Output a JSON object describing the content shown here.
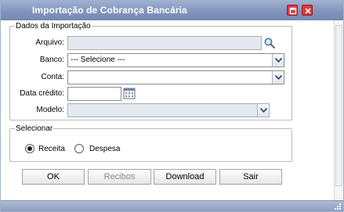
{
  "window": {
    "title": "Importação de Cobrança Bancária"
  },
  "import_group": {
    "legend": "Dados da Importação",
    "arquivo_label": "Arquivo:",
    "arquivo_value": "",
    "banco_label": "Banco:",
    "banco_value": "--- Selecione ---",
    "conta_label": "Conta:",
    "conta_value": "",
    "data_credito_label": "Data crédito:",
    "data_credito_value": "",
    "modelo_label": "Modelo:",
    "modelo_value": ""
  },
  "select_group": {
    "legend": "Selecionar",
    "options": [
      {
        "label": "Receita",
        "selected": true
      },
      {
        "label": "Despesa",
        "selected": false
      }
    ]
  },
  "buttons": {
    "ok": "OK",
    "recibos": "Recibos",
    "download": "Download",
    "sair": "Sair"
  },
  "icons": {
    "search": "magnifier-icon",
    "calendar": "calendar-icon",
    "maximize": "maximize-icon",
    "close": "close-icon"
  },
  "colors": {
    "titlebar": "#8194bb",
    "close_button": "#e0353a",
    "disabled_field": "#e4e8ef"
  }
}
